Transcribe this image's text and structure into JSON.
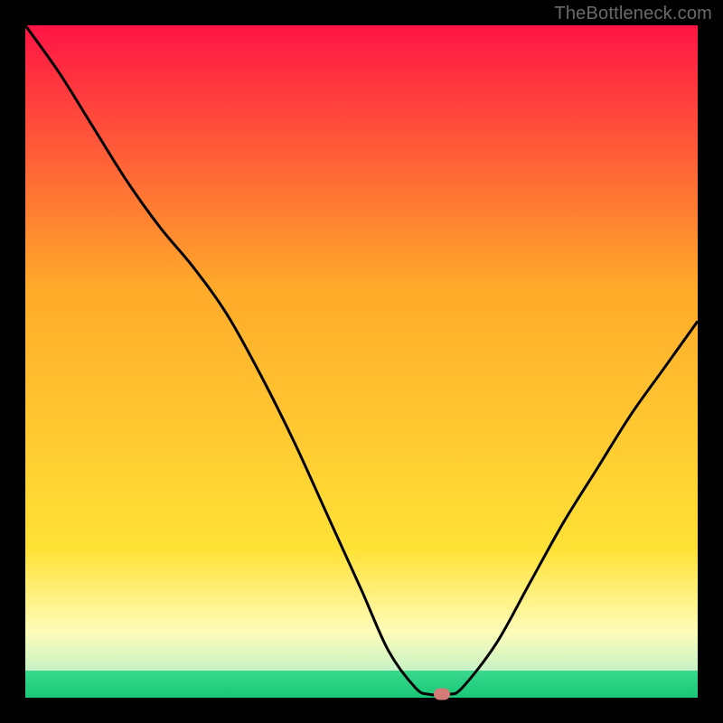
{
  "watermark": "TheBottleneck.com",
  "colors": {
    "black": "#000000",
    "marker": "#d47b77",
    "watermark_text": "#6a6a6a",
    "curve": "#000000"
  },
  "chart_data": {
    "type": "line",
    "title": "",
    "xlabel": "",
    "ylabel": "",
    "xlim": [
      0,
      100
    ],
    "ylim": [
      0,
      100
    ],
    "background_gradient": [
      {
        "y_from": 100,
        "y_to": 22,
        "stops": [
          {
            "pos": 0.0,
            "color": "#ff1445"
          },
          {
            "pos": 0.5,
            "color": "#ffaa2a"
          },
          {
            "pos": 1.0,
            "color": "#ffe236"
          }
        ]
      },
      {
        "y_from": 22,
        "y_to": 10,
        "stops": [
          {
            "pos": 0.0,
            "color": "#ffe236"
          },
          {
            "pos": 1.0,
            "color": "#fffcb8"
          }
        ]
      },
      {
        "y_from": 10,
        "y_to": 4,
        "stops": [
          {
            "pos": 0.0,
            "color": "#fffcb8"
          },
          {
            "pos": 1.0,
            "color": "#c7f3c6"
          }
        ]
      },
      {
        "y_from": 4,
        "y_to": 0,
        "stops": [
          {
            "pos": 0.0,
            "color": "#3ad98d"
          },
          {
            "pos": 1.0,
            "color": "#18c877"
          }
        ]
      }
    ],
    "series": [
      {
        "name": "bottleneck-curve",
        "x": [
          0,
          5,
          10,
          15,
          20,
          25,
          30,
          35,
          40,
          45,
          50,
          54,
          58,
          60,
          63,
          65,
          70,
          75,
          80,
          85,
          90,
          95,
          100
        ],
        "values": [
          100,
          93,
          85,
          77,
          70,
          64,
          57,
          48,
          38,
          27,
          16,
          7,
          1.5,
          0.5,
          0.5,
          1.5,
          8,
          17,
          26,
          34,
          42,
          49,
          56
        ]
      }
    ],
    "marker": {
      "x": 62,
      "y": 0.5
    }
  }
}
